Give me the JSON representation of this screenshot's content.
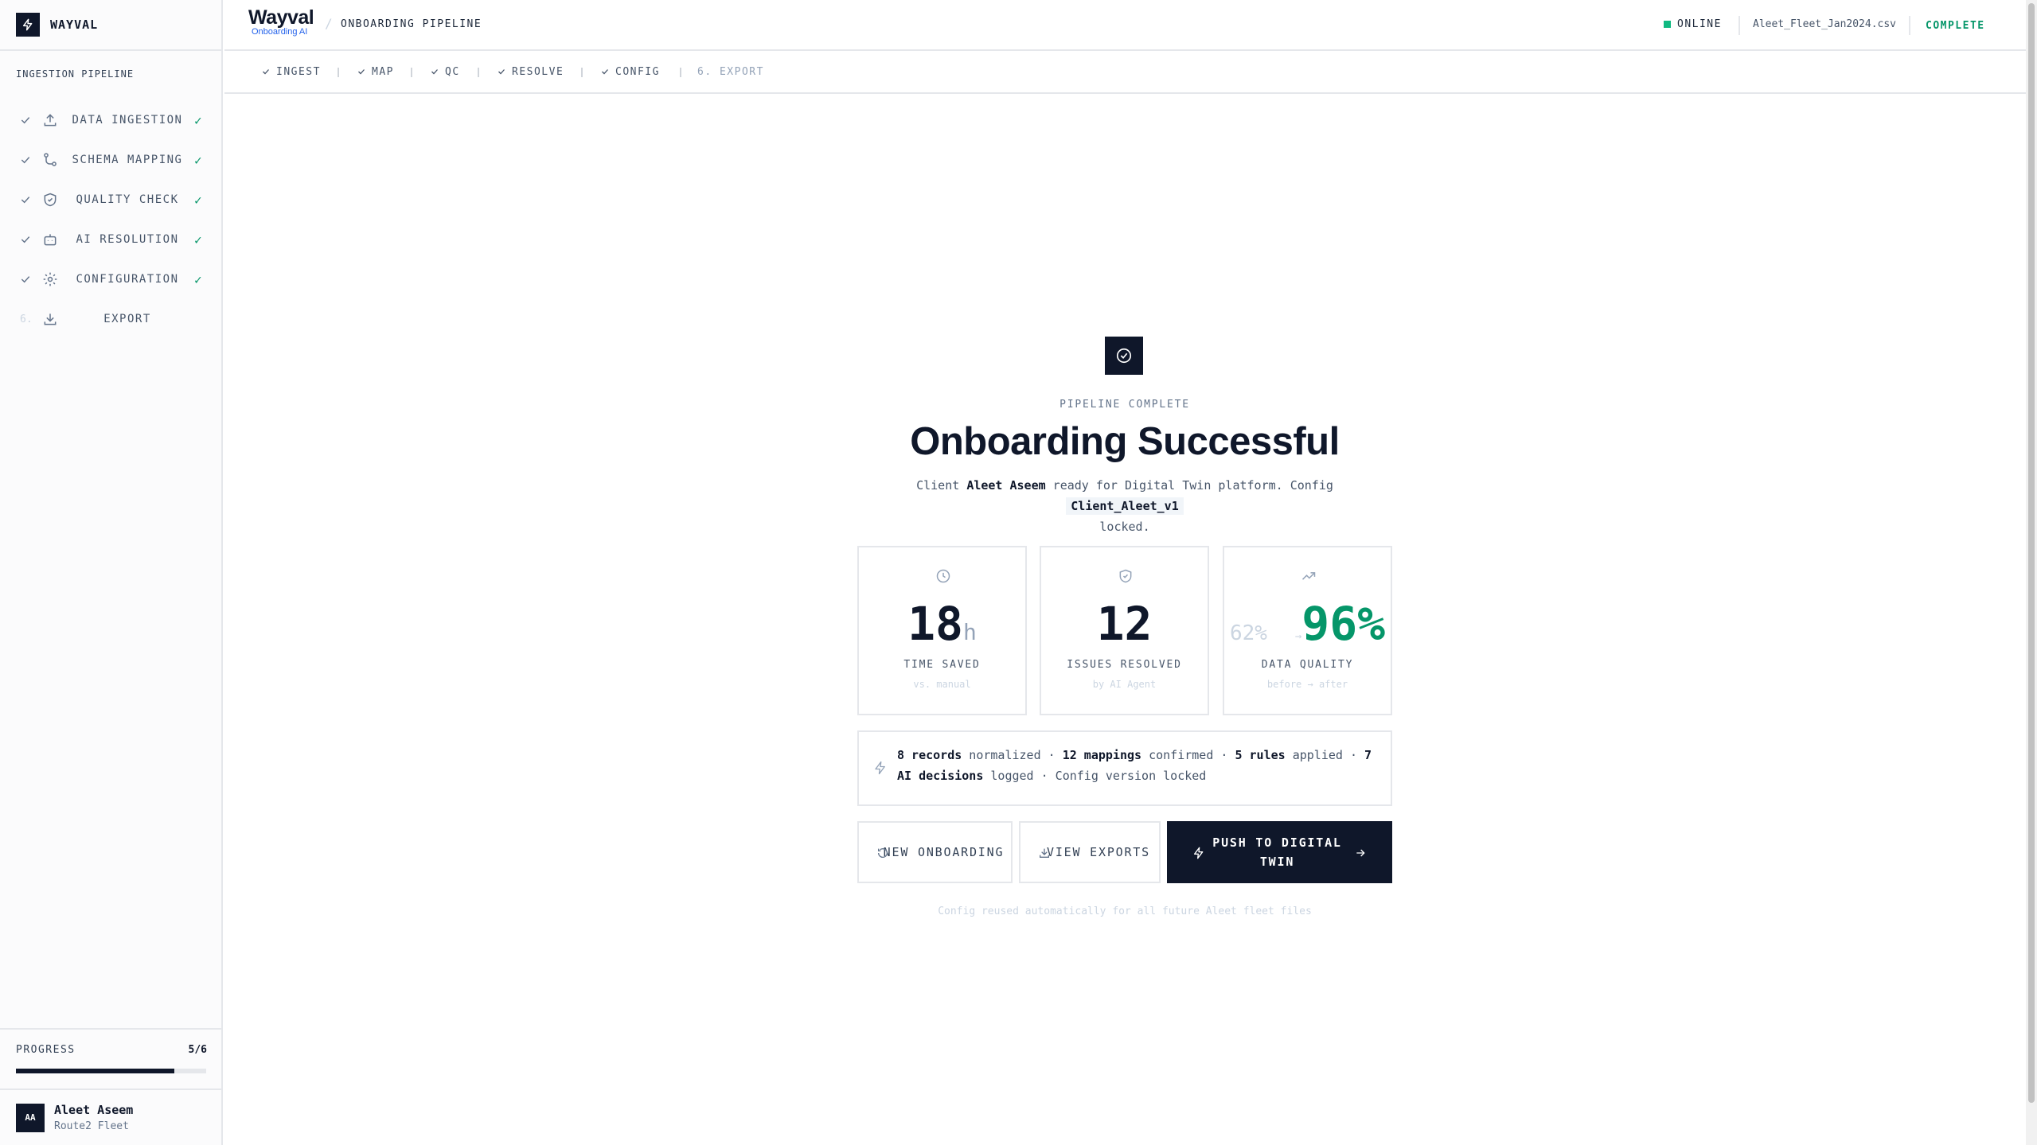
{
  "app": {
    "brand": "WAYVAL",
    "logo_main": "Wayval",
    "logo_sub": "Onboarding AI",
    "breadcrumb": "ONBOARDING PIPELINE"
  },
  "header": {
    "status": "ONLINE",
    "filename": "Aleet_Fleet_Jan2024.csv",
    "complete": "COMPLETE"
  },
  "sidebar": {
    "section_label": "INGESTION PIPELINE",
    "steps": [
      {
        "label": "DATA INGESTION",
        "icon": "upload-icon",
        "done": "✓"
      },
      {
        "label": "SCHEMA MAPPING",
        "icon": "git-branch-icon",
        "done": "✓"
      },
      {
        "label": "QUALITY CHECK",
        "icon": "shield-icon",
        "done": "✓"
      },
      {
        "label": "AI RESOLUTION",
        "icon": "bot-icon",
        "done": "✓"
      },
      {
        "label": "CONFIGURATION",
        "icon": "gear-icon",
        "done": "✓"
      },
      {
        "label": "EXPORT",
        "icon": "download-icon",
        "number": "6."
      }
    ],
    "progress_label": "PROGRESS",
    "progress_value": "5/6",
    "progress_fraction": 0.8333,
    "user": {
      "initials": "AA",
      "name": "Aleet Aseem",
      "org": "Route2 Fleet"
    }
  },
  "tabs": [
    {
      "label": "INGEST",
      "state": "done"
    },
    {
      "label": "MAP",
      "state": "done"
    },
    {
      "label": "QC",
      "state": "done"
    },
    {
      "label": "RESOLVE",
      "state": "done"
    },
    {
      "label": "CONFIG",
      "state": "done"
    },
    {
      "label": "6. EXPORT",
      "state": "pending"
    }
  ],
  "main": {
    "kicker": "PIPELINE COMPLETE",
    "title": "Onboarding Successful",
    "desc_client_prefix": "Client ",
    "desc_client": "Aleet Aseem",
    "desc_middle": " ready for Digital Twin platform. Config ",
    "desc_config": "Client_Aleet_v1",
    "desc_suffix": " locked.",
    "stats": {
      "time_value": "18",
      "time_unit": "h",
      "time_label": "TIME SAVED",
      "time_sub": "vs. manual",
      "issues_value": "12",
      "issues_label": "ISSUES RESOLVED",
      "issues_sub": "by AI Agent",
      "quality_before": "62%",
      "quality_arrow": "→",
      "quality_after": "96%",
      "quality_label": "DATA QUALITY",
      "quality_sub": "before → after"
    },
    "summary": {
      "records": "8 records",
      "t1": " normalized · ",
      "mappings": "12 mappings",
      "t2": " confirmed · ",
      "rules": "5 rules",
      "t3": " applied · ",
      "decisions": "7 AI decisions",
      "t4": " logged · Config version locked"
    },
    "buttons": {
      "new_onboarding": "NEW ONBOARDING",
      "view_exports": "VIEW EXPORTS",
      "push": "PUSH TO DIGITAL TWIN"
    },
    "footnote": "Config reused automatically for all future Aleet fleet files"
  },
  "colors": {
    "accent": "#0f172a",
    "success": "#059669",
    "online": "#10b981"
  }
}
